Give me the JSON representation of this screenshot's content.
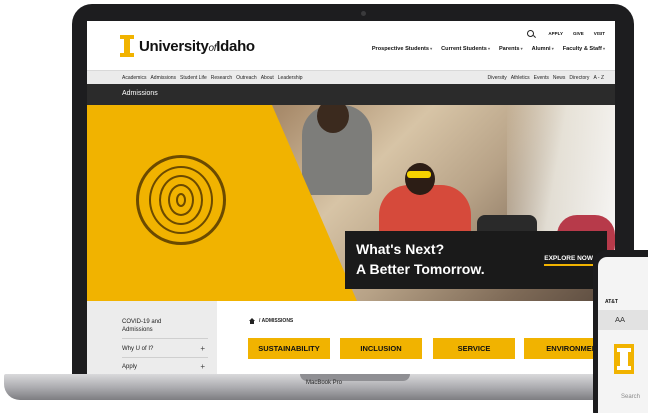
{
  "header": {
    "logo": {
      "pre": "University",
      "of": "of",
      "post": "Idaho"
    },
    "utility": [
      "APPLY",
      "GIVE",
      "VISIT"
    ],
    "main_nav": [
      "Prospective Students",
      "Current Students",
      "Parents",
      "Alumni",
      "Faculty & Staff"
    ]
  },
  "sub_nav": {
    "left": [
      "Academics",
      "Admissions",
      "Student Life",
      "Research",
      "Outreach",
      "About",
      "Leadership"
    ],
    "right": [
      "Diversity",
      "Athletics",
      "Events",
      "News",
      "Directory",
      "A - Z"
    ]
  },
  "section": {
    "title": "Admissions"
  },
  "hero": {
    "line1": "What's Next?",
    "line2": "A Better Tomorrow.",
    "cta": "EXPLORE NOW"
  },
  "side_nav": [
    {
      "label": "COVID-19 and Admissions"
    },
    {
      "label": "Why U of I?",
      "plus": "+"
    },
    {
      "label": "Apply",
      "plus": "+"
    }
  ],
  "breadcrumb": "/ ADMISSIONS",
  "tags": [
    "SUSTAINABILITY",
    "INCLUSION",
    "SERVICE",
    "ENVIRONMENT"
  ],
  "laptop_label": "MacBook Pro",
  "phone": {
    "carrier": "AT&T",
    "aa": "AA",
    "search": "Search"
  },
  "colors": {
    "brand_gold": "#f1b300",
    "dark_bar": "#2b2b2b",
    "subnav_bg": "#ebebeb"
  }
}
